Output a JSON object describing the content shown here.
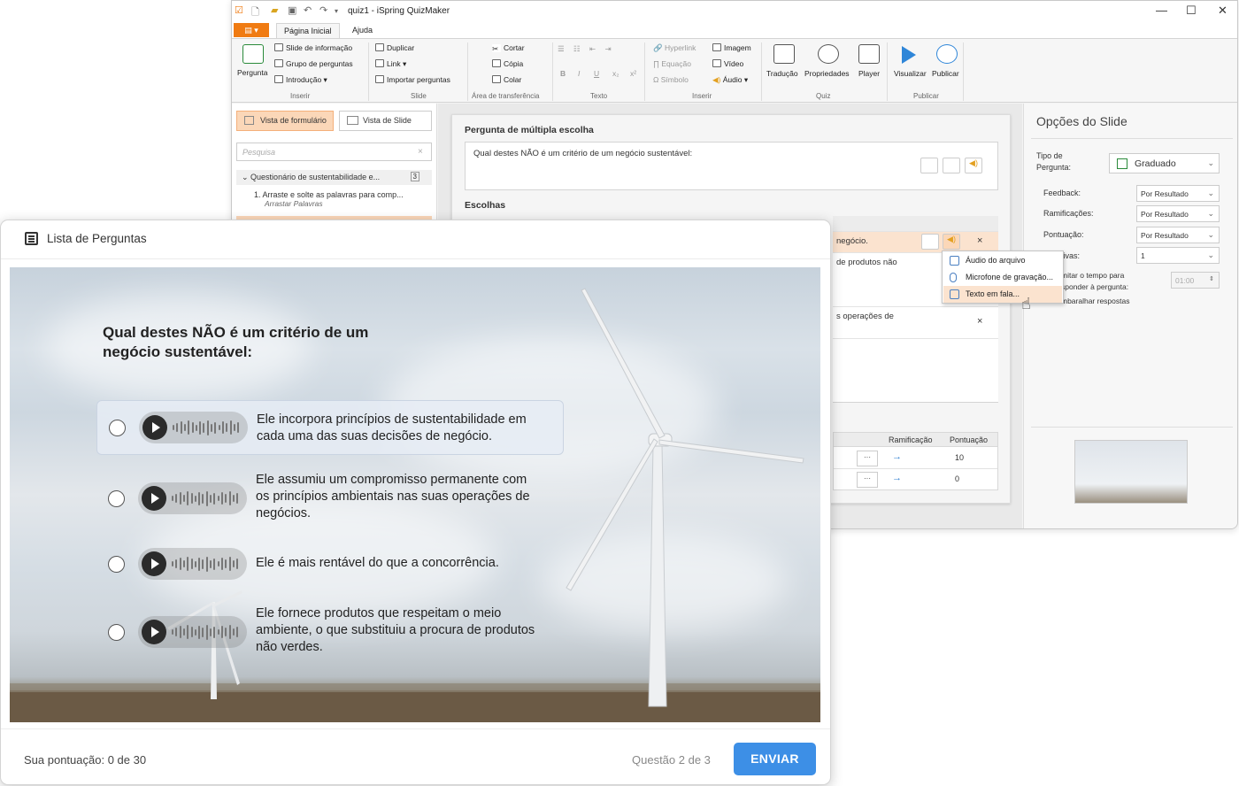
{
  "app": {
    "window_title": "quiz1 - iSpring QuizMaker",
    "tabs": [
      {
        "label": "Página Inicial"
      },
      {
        "label": "Ajuda"
      }
    ],
    "ribbon": {
      "inserir": {
        "pergunta": "Pergunta",
        "slide_info": "Slide de informação",
        "grupo": "Grupo de perguntas",
        "introducao": "Introdução",
        "group_label": "Inserir"
      },
      "slide": {
        "duplicar": "Duplicar",
        "link": "Link",
        "importar": "Importar perguntas",
        "group_label": "Slide"
      },
      "clipboard": {
        "cortar": "Cortar",
        "copia": "Cópia",
        "colar": "Colar",
        "group_label": "Área de transferência"
      },
      "texto": {
        "group_label": "Texto",
        "bold": "B",
        "italic": "I",
        "underline": "U",
        "sub": "x₂",
        "sup": "x²"
      },
      "inserir2": {
        "hyperlink": "Hyperlink",
        "equacao": "Equação",
        "simbolo": "Símbolo",
        "imagem": "Imagem",
        "video": "Vídeo",
        "audio": "Áudio",
        "group_label": "Inserir"
      },
      "quiz": {
        "traducao": "Tradução",
        "propriedades": "Propriedades",
        "player": "Player",
        "group_label": "Quiz"
      },
      "publicar": {
        "visualizar": "Visualizar",
        "publicar": "Publicar",
        "group_label": "Publicar"
      }
    },
    "left_panel": {
      "vista_formulario": "Vista de formulário",
      "vista_slide": "Vista de Slide",
      "search_placeholder": "Pesquisa",
      "tree_group": "Questionário de sustentabilidade e...",
      "tree_group_count": "3",
      "item1_title": "1. Arraste e solte as palavras para comp...",
      "item1_sub": "Arrastar Palavras"
    },
    "editor": {
      "section_title": "Pergunta de múltipla escolha",
      "question_text": "Qual destes NÃO é um critério de um negócio sustentável:",
      "choices_label": "Escolhas",
      "choice_fragments": [
        "negócio.",
        "de produtos não",
        "s operações de"
      ],
      "col_ramificacao": "Ramificação",
      "col_pontuacao": "Pontuação",
      "row_scores": [
        "10",
        "0"
      ],
      "ellipsis": "···",
      "arrow": "→",
      "close": "×"
    },
    "context_menu": {
      "items": [
        {
          "label": "Áudio do arquivo"
        },
        {
          "label": "Microfone de gravação..."
        },
        {
          "label": "Texto em fala..."
        }
      ]
    },
    "right_panel": {
      "title": "Opções do Slide",
      "tipo_label": "Tipo de Pergunta:",
      "tipo_value": "Graduado",
      "feedback_label": "Feedback:",
      "feedback_value": "Por Resultado",
      "ramificacoes_label": "Ramificações:",
      "ramificacoes_value": "Por Resultado",
      "pontuacao_label": "Pontuação:",
      "pontuacao_value": "Por Resultado",
      "tentativas_label": "tivas:",
      "tentativas_value": "1",
      "limitar_label": "mitar o tempo para\nsponder à pergunta:",
      "tempo_value": "01:00",
      "embaralhar_label": "mbaralhar respostas"
    }
  },
  "player": {
    "header_label": "Lista de Perguntas",
    "question": "Qual destes NÃO é um critério de um negócio sustentável:",
    "options": [
      {
        "text": "Ele incorpora princípios de sustentabilidade em cada uma das suas decisões de negócio.",
        "highlighted": true
      },
      {
        "text": "Ele assumiu um compromisso permanente com os princípios ambientais nas suas operações de negócios.",
        "highlighted": false
      },
      {
        "text": "Ele é mais rentável do que a concorrência.",
        "highlighted": false
      },
      {
        "text": "Ele fornece produtos que respeitam o meio ambiente, o que substituiu a procura de produtos não verdes.",
        "highlighted": false
      }
    ],
    "score_text": "Sua pontuação: 0 de 30",
    "question_counter": "Questão 2 de 3",
    "submit_label": "ENVIAR",
    "accent_color": "#3d8fe6"
  }
}
